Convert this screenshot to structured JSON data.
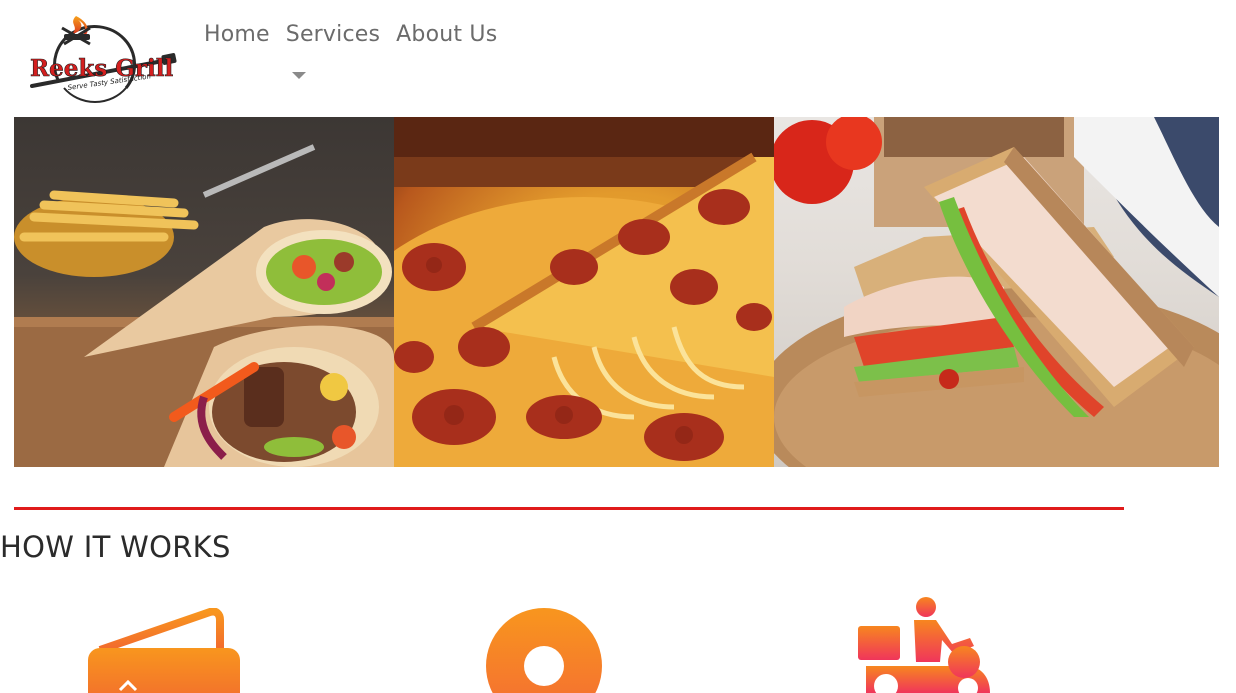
{
  "brand": {
    "name": "Reeks Grill",
    "tagline": "Serve Tasty Satisfaction",
    "colors": {
      "red": "#d41f1f",
      "dark": "#1a1a1a",
      "accent_orange": "#f28a1e",
      "accent_pink": "#f0355b"
    }
  },
  "nav": {
    "items": [
      {
        "label": "Home"
      },
      {
        "label": "Services",
        "has_dropdown": true
      },
      {
        "label": "About Us"
      }
    ]
  },
  "hero": {
    "images": [
      {
        "icon": "wrap-photo"
      },
      {
        "icon": "pizza-photo"
      },
      {
        "icon": "sandwich-photo"
      }
    ]
  },
  "how_it_works": {
    "title": "HOW IT WORKS",
    "steps": [
      {
        "icon": "wallet-icon"
      },
      {
        "icon": "location-pin-icon"
      },
      {
        "icon": "delivery-scooter-icon"
      }
    ]
  }
}
